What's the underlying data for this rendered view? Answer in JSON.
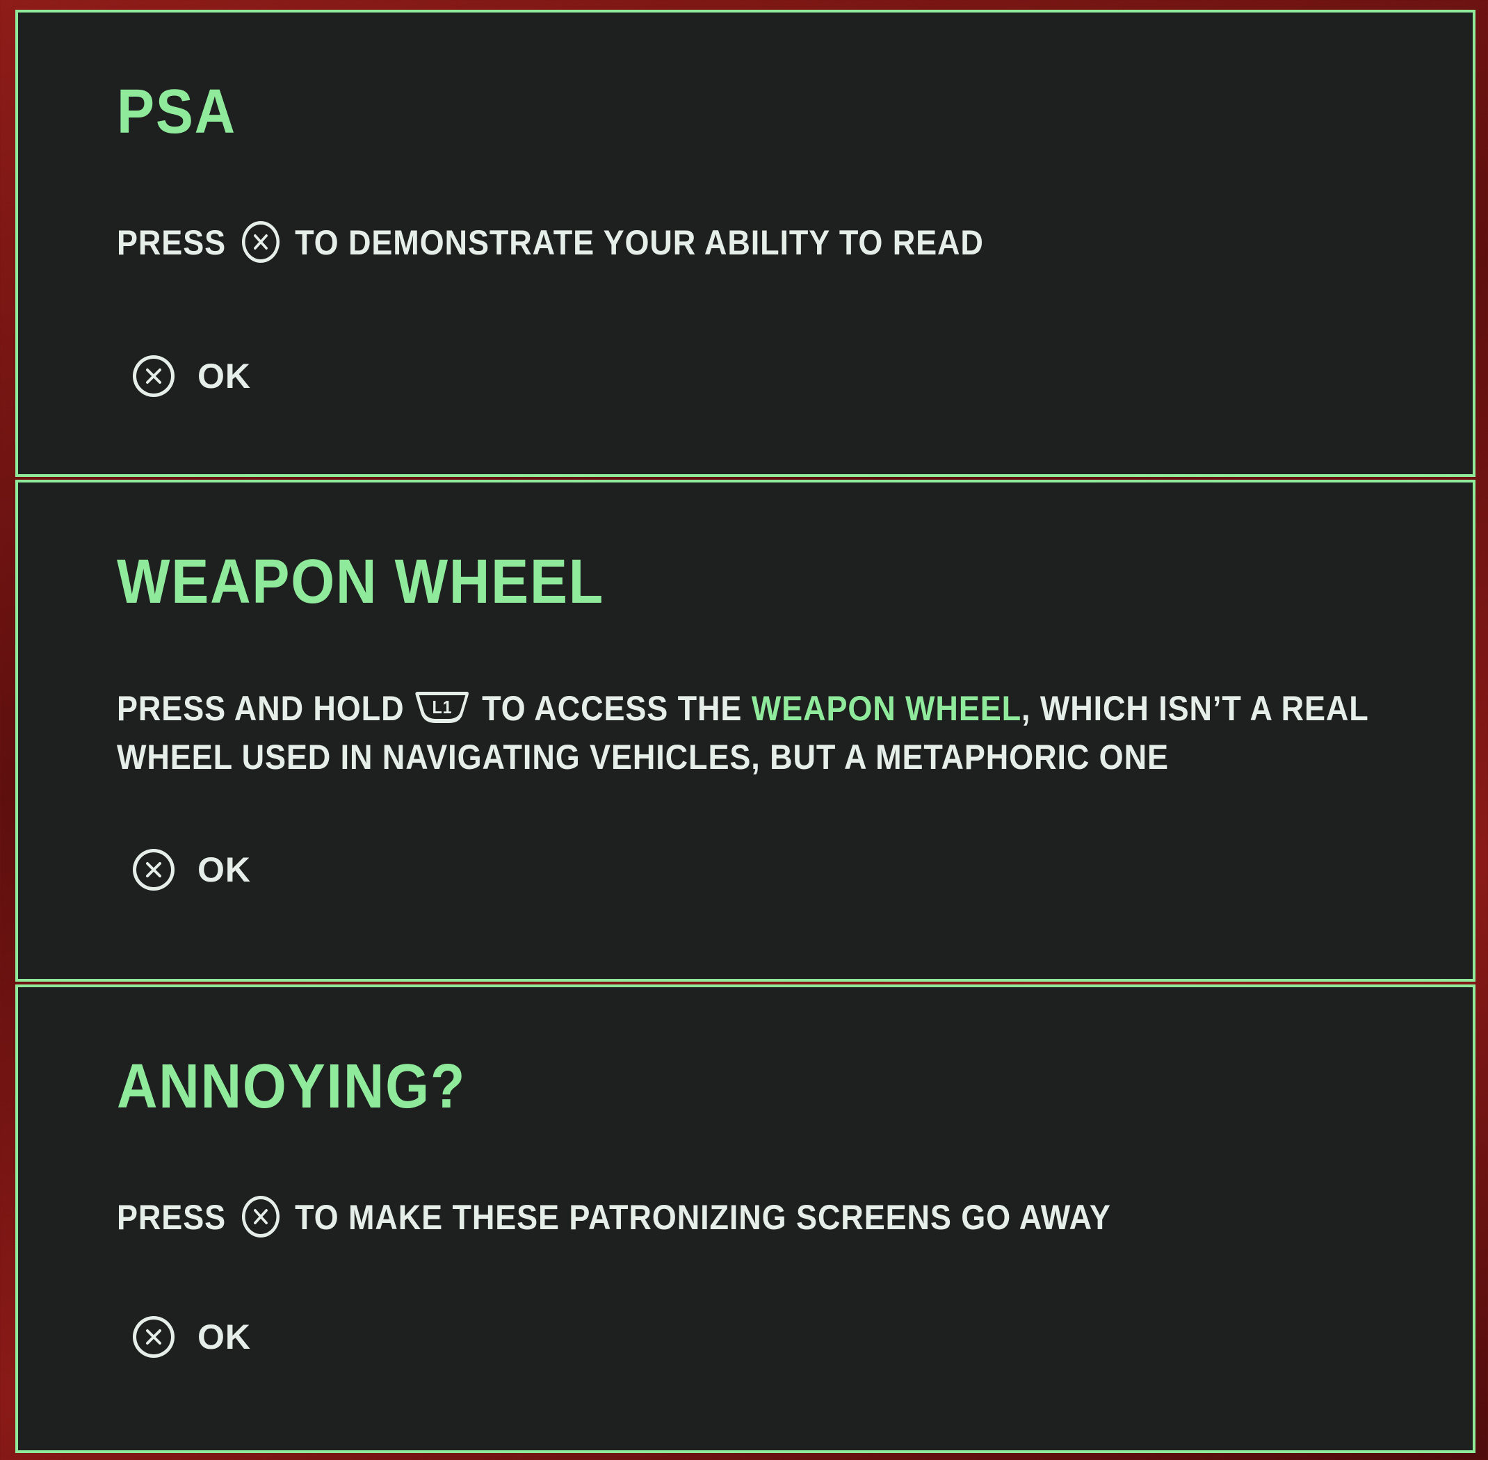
{
  "colors": {
    "accent": "#8fea9c",
    "panel_bg": "#1e201f",
    "text": "#e6eeea",
    "backdrop": "#7a1614"
  },
  "panels": [
    {
      "title": "PSA",
      "text_before_icon": "PRESS",
      "icon": "cross-button-icon",
      "text_after_icon": "TO DEMONSTRATE YOUR ABILITY TO READ",
      "ok_icon": "cross-button-icon",
      "ok_label": "OK"
    },
    {
      "title": "WEAPON WHEEL",
      "text_before_icon": "PRESS AND HOLD",
      "icon": "l1-button-icon",
      "icon_label": "L1",
      "text_after_icon": "TO ACCESS THE",
      "highlight": "WEAPON WHEEL",
      "text_after_highlight": ", WHICH ISN’T A REAL WHEEL USED IN NAVIGATING VEHICLES, BUT A METAPHORIC ONE",
      "ok_icon": "cross-button-icon",
      "ok_label": "OK"
    },
    {
      "title": "ANNOYING?",
      "text_before_icon": "PRESS",
      "icon": "cross-button-icon",
      "text_after_icon": "TO MAKE THESE PATRONIZING SCREENS GO AWAY",
      "ok_icon": "cross-button-icon",
      "ok_label": "OK"
    }
  ]
}
